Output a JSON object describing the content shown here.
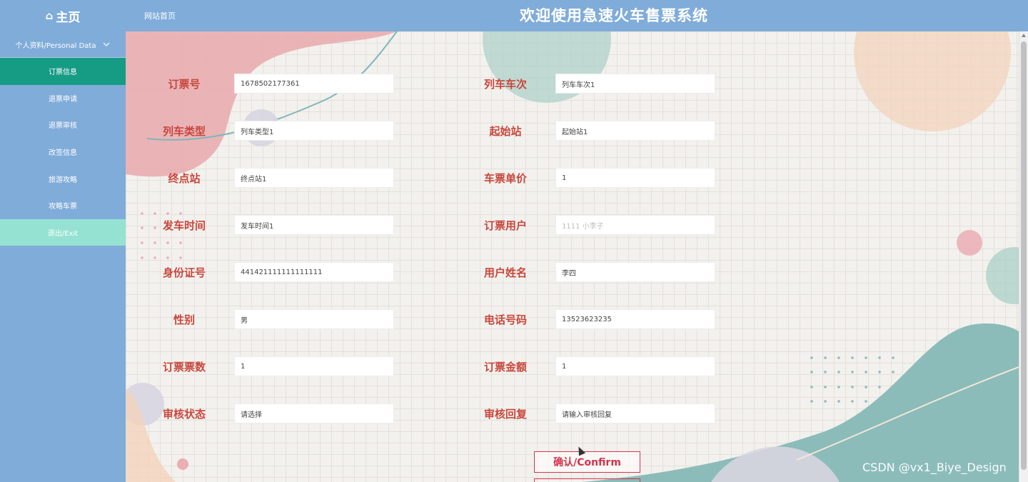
{
  "header": {
    "home_icon": "home-icon",
    "home_label": "主页",
    "site_link": "网站首页",
    "title": "欢迎使用急速火车售票系统"
  },
  "sidebar": {
    "group_label": "个人资料/Personal Data",
    "items": [
      {
        "label": "订票信息",
        "active": true
      },
      {
        "label": "退票申请"
      },
      {
        "label": "退票审核"
      },
      {
        "label": "改签信息"
      },
      {
        "label": "旅游攻略"
      },
      {
        "label": "攻略车票"
      },
      {
        "label": "退出/Exit",
        "exit": true
      }
    ]
  },
  "form": {
    "left": [
      {
        "label": "订票号",
        "value": "1678502177361"
      },
      {
        "label": "列车类型",
        "value": "列车类型1"
      },
      {
        "label": "终点站",
        "value": "终点站1"
      },
      {
        "label": "发车时间",
        "value": "发车时间1"
      },
      {
        "label": "身份证号",
        "value": "441421111111111111"
      },
      {
        "label": "性别",
        "value": "男"
      },
      {
        "label": "订票票数",
        "value": "1"
      },
      {
        "label": "审核状态",
        "value": "请选择"
      }
    ],
    "right": [
      {
        "label": "列车车次",
        "value": "列车车次1"
      },
      {
        "label": "起始站",
        "value": "起始站1"
      },
      {
        "label": "车票单价",
        "value": "1"
      },
      {
        "label": "订票用户",
        "value": "1111 小李子",
        "placeholder_style": true
      },
      {
        "label": "用户姓名",
        "value": "李四"
      },
      {
        "label": "电话号码",
        "value": "13523623235"
      },
      {
        "label": "订票金额",
        "value": "1"
      },
      {
        "label": "审核回复",
        "value": "请输入审核回复"
      }
    ]
  },
  "buttons": {
    "confirm": "确认/Confirm"
  },
  "watermark": "CSDN @vx1_Biye_Design",
  "colors": {
    "header_bg": "#80acd9",
    "active_item": "#169b85",
    "exit_item": "#95e2d2",
    "label": "#c8473d",
    "confirm": "#d6334b"
  }
}
